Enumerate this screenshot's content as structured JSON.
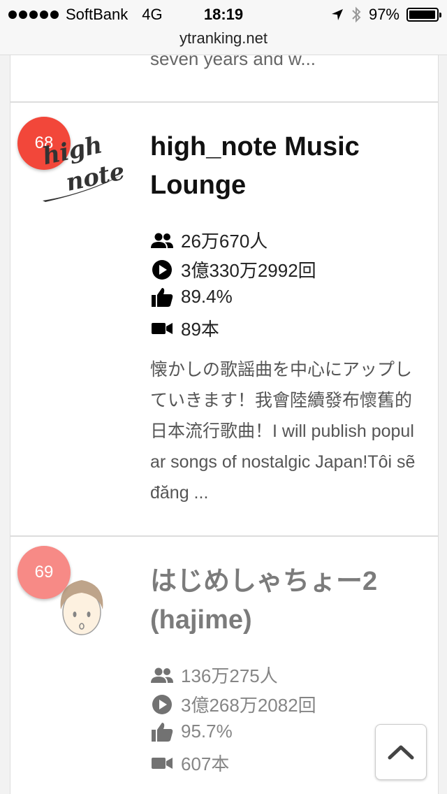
{
  "status_bar": {
    "carrier": "SoftBank",
    "network": "4G",
    "time": "18:19",
    "battery": "97%",
    "battery_level": 0.97
  },
  "browser": {
    "url": "ytranking.net"
  },
  "previous_card": {
    "description_tail": "seven years and w..."
  },
  "channels": [
    {
      "rank": "68",
      "badge_color": "#f2473a",
      "title": "high_note Music Lounge",
      "logo_text_line1": "high",
      "logo_text_line2": "note",
      "subscribers": "26万670人",
      "views": "3億330万2992回",
      "like_ratio": "89.4%",
      "videos": "89本",
      "description": "懐かしの歌謡曲を中心にアップしていきます！我會陸續發布懷舊的日本流行歌曲！I will publish popular songs of nostalgic Japan!Tôi sẽ đăng ..."
    },
    {
      "rank": "69",
      "badge_color": "#f78a86",
      "title": "はじめしゃちょー2 (hajime)",
      "subscribers": "136万275人",
      "views": "3億268万2082回",
      "like_ratio": "95.7%",
      "videos": "607本"
    }
  ],
  "icons": {
    "subscribers": "people-icon",
    "views": "play-circle-icon",
    "likes": "thumbs-up-icon",
    "videos": "video-camera-icon",
    "scroll_top": "chevron-up-icon"
  }
}
